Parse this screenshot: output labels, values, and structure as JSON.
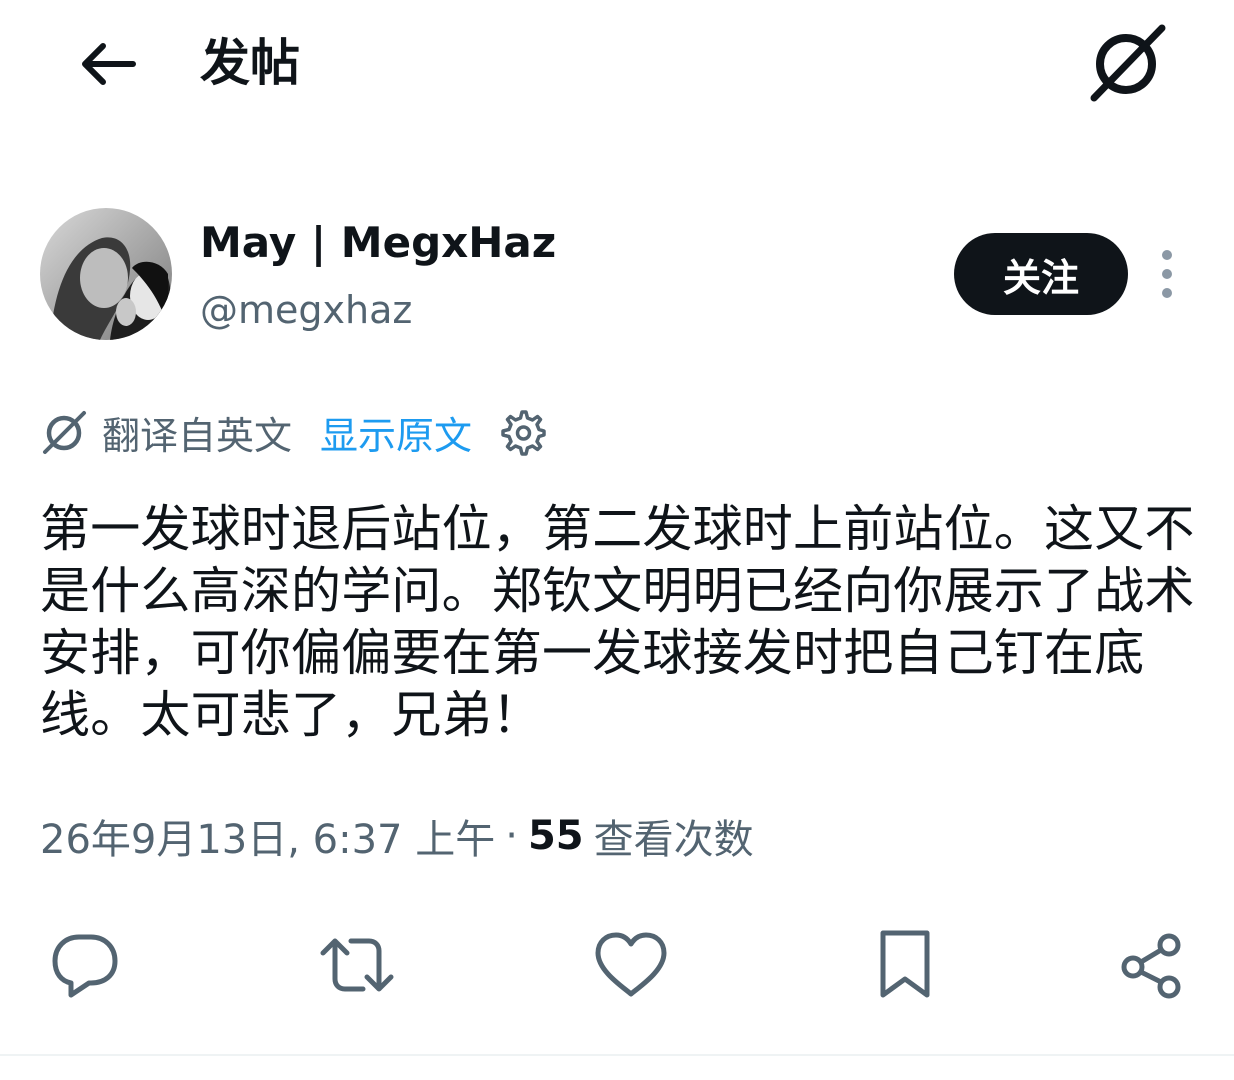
{
  "header": {
    "title": "发帖",
    "back_icon": "arrow-left-icon",
    "grok_icon": "grok-icon"
  },
  "post": {
    "author": {
      "display_name": "May | MegxHaz",
      "handle": "@megxhaz",
      "avatar": "avatar-photo"
    },
    "follow_label": "关注",
    "translation": {
      "label": "翻译自英文",
      "show_original": "显示原文"
    },
    "text": "第一发球时退后站位，第二发球时上前站位。这又不是什么高深的学问。郑钦文明明已经向你展示了战术安排，可你偏偏要在第一发球接发时把自己钉在底线。太可悲了，兄弟！",
    "timestamp": "26年9月13日, 6:37 上午",
    "separator": "·",
    "views_count": "55",
    "views_label": "查看次数"
  },
  "actions": [
    {
      "name": "reply",
      "icon": "reply-icon"
    },
    {
      "name": "repost",
      "icon": "repost-icon"
    },
    {
      "name": "like",
      "icon": "heart-icon"
    },
    {
      "name": "bookmark",
      "icon": "bookmark-icon"
    },
    {
      "name": "share",
      "icon": "share-icon"
    }
  ],
  "colors": {
    "text_primary": "#0f1419",
    "text_secondary": "#536471",
    "link": "#1d9bf0",
    "follow_bg": "#0f1419"
  }
}
